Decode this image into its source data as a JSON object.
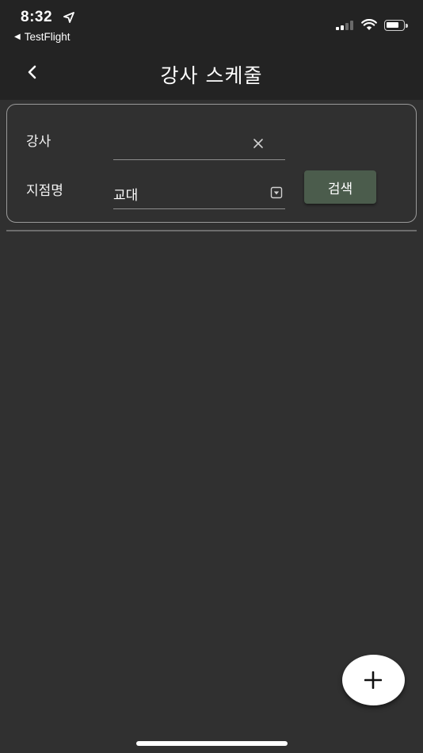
{
  "status_bar": {
    "time": "8:32",
    "back_app_label": "TestFlight",
    "icons": [
      "location-arrow-icon",
      "signal-icon",
      "wifi-icon",
      "battery-icon"
    ]
  },
  "app_bar": {
    "title": "강사 스케줄",
    "back_icon": "chevron-left-icon"
  },
  "search_form": {
    "instructor": {
      "label": "강사",
      "value": "",
      "clear_icon": "close-icon"
    },
    "branch": {
      "label": "지점명",
      "value": "교대",
      "dropdown_icon": "dropdown-icon"
    },
    "search_button_label": "검색"
  },
  "fab": {
    "icon": "plus-icon"
  },
  "colors": {
    "background": "#303030",
    "app_bar": "#232323",
    "search_button": "#4b5c4c",
    "fab": "#ffffff"
  }
}
